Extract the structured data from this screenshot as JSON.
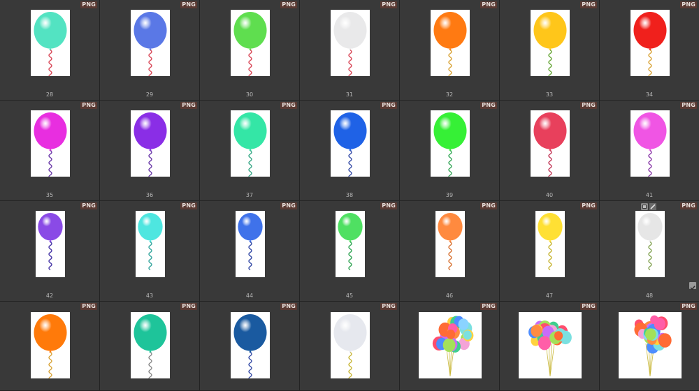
{
  "badge_label": "PNG",
  "thumbnails": [
    {
      "number": "28",
      "color": "#53e3c2",
      "ribbon": "#d94a5a"
    },
    {
      "number": "29",
      "color": "#5a78e6",
      "ribbon": "#d94a5a"
    },
    {
      "number": "30",
      "color": "#5fde4f",
      "ribbon": "#d94a5a"
    },
    {
      "number": "31",
      "color": "#e9e9ea",
      "ribbon": "#d94a5a"
    },
    {
      "number": "32",
      "color": "#ff7a12",
      "ribbon": "#d9a53b"
    },
    {
      "number": "33",
      "color": "#ffc61a",
      "ribbon": "#6aa83c"
    },
    {
      "number": "34",
      "color": "#f0201c",
      "ribbon": "#d9a53b"
    },
    {
      "number": "35",
      "color": "#e82ee0",
      "ribbon": "#6b3aa8"
    },
    {
      "number": "36",
      "color": "#8a2ee6",
      "ribbon": "#6b3aa8"
    },
    {
      "number": "37",
      "color": "#34e6a6",
      "ribbon": "#3aa887"
    },
    {
      "number": "38",
      "color": "#1f62e6",
      "ribbon": "#3a4fa8"
    },
    {
      "number": "39",
      "color": "#36f036",
      "ribbon": "#3aa85c"
    },
    {
      "number": "40",
      "color": "#e8405c",
      "ribbon": "#c23a5a"
    },
    {
      "number": "41",
      "color": "#f055e4",
      "ribbon": "#8a3aa8"
    },
    {
      "number": "42",
      "color": "#8a4ae6",
      "ribbon": "#4a3aa8"
    },
    {
      "number": "43",
      "color": "#4ee6e0",
      "ribbon": "#3aa8a0"
    },
    {
      "number": "44",
      "color": "#3f72ea",
      "ribbon": "#3a4fa8"
    },
    {
      "number": "45",
      "color": "#4fe062",
      "ribbon": "#3aa85c"
    },
    {
      "number": "46",
      "color": "#ff8a3f",
      "ribbon": "#d9783b"
    },
    {
      "number": "47",
      "color": "#ffe034",
      "ribbon": "#c9b83b"
    },
    {
      "number": "48",
      "color": "#e6e6e6",
      "ribbon": "#8aa85c"
    },
    {
      "number": "",
      "color": "#ff7a0a",
      "ribbon": "#d9a53b"
    },
    {
      "number": "",
      "color": "#1ec49a",
      "ribbon": "#8a8a8a"
    },
    {
      "number": "",
      "color": "#1a5aa0",
      "ribbon": "#3a4fa8"
    },
    {
      "number": "",
      "color": "#e6e8ee",
      "ribbon": "#c9b83b"
    },
    {
      "number": "",
      "color": "bunch",
      "ribbon": "#c9b83b"
    },
    {
      "number": "",
      "color": "bunch",
      "ribbon": "#c9b83b"
    },
    {
      "number": "",
      "color": "bunch",
      "ribbon": "#c9b83b"
    }
  ],
  "selected_index": 20
}
